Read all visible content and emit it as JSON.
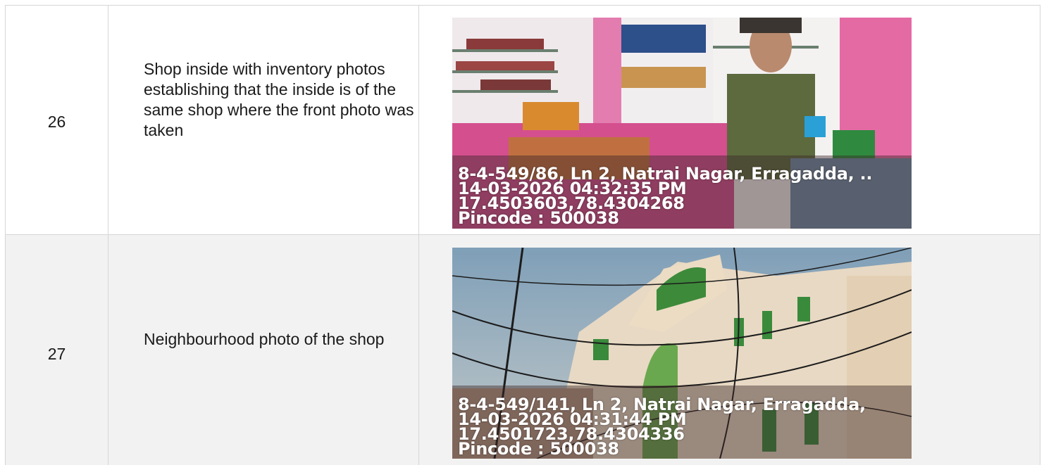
{
  "rows": [
    {
      "number": "26",
      "description": "Shop inside with inventory photos establishing that the inside is of the same shop where the front photo was taken",
      "photo": {
        "subject": "shop-interior-photo",
        "address": "8-4-549/86, Ln 2, Natrai Nagar, Erragadda, ..",
        "datetime": "14-03-2026 04:32:35 PM",
        "coords": "17.4503603,78.4304268",
        "pincode": "Pincode : 500038"
      }
    },
    {
      "number": "27",
      "description": "Neighbourhood photo of the shop",
      "photo": {
        "subject": "neighbourhood-building-photo",
        "address": "8-4-549/141, Ln 2, Natrai Nagar, Erragadda,",
        "datetime": "14-03-2026 04:31:44 PM",
        "coords": "17.4501723,78.4304336",
        "pincode": "Pincode : 500038"
      }
    }
  ],
  "colors": {
    "grid": "#d6d6d6",
    "row_alt": "#f2f2f2",
    "shop_wall": "#e0559a",
    "building_green": "#3a8a3c"
  }
}
